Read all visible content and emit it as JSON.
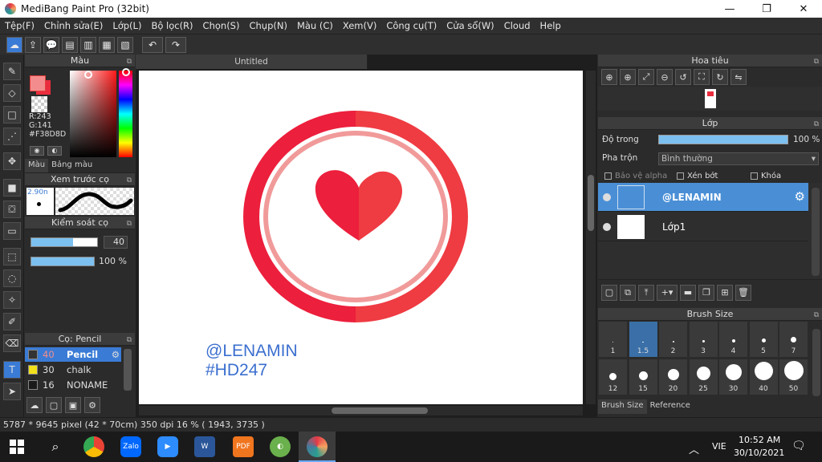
{
  "window": {
    "title": "MediBang Paint Pro (32bit)",
    "minimize": "—",
    "maximize": "❐",
    "close": "✕"
  },
  "menu": [
    "Tệp(F)",
    "Chỉnh sửa(E)",
    "Lớp(L)",
    "Bộ lọc(R)",
    "Chọn(S)",
    "Chụp(N)",
    "Màu (C)",
    "Xem(V)",
    "Công cụ(T)",
    "Cửa sổ(W)",
    "Cloud",
    "Help"
  ],
  "color_panel": {
    "title": "Màu",
    "r": "R:243",
    "g": "G:141",
    "hex": "#F38D8D",
    "tabs": [
      "Màu",
      "Bảng màu"
    ]
  },
  "brush_preview": {
    "title": "Xem trước cọ",
    "size": "2.90n"
  },
  "brush_control": {
    "title": "Kiểm soát cọ",
    "size_value": "40",
    "opacity_value": "100 %"
  },
  "brush_panel": {
    "title": "Cọ: Pencil",
    "items": [
      {
        "size": "40",
        "name": "Pencil",
        "color": "#F38D8D"
      },
      {
        "size": "30",
        "name": "chalk",
        "color": "#f2e11a"
      },
      {
        "size": "16",
        "name": "NONAME",
        "color": "#1a1a1a"
      }
    ]
  },
  "canvas": {
    "tab": "Untitled",
    "text1": "@LENAMIN",
    "text2": "#HD247"
  },
  "navigator": {
    "title": "Hoa tiêu"
  },
  "layer_panel": {
    "title": "Lớp",
    "opacity_label": "Độ trong",
    "opacity_value": "100 %",
    "opacity_fraction": 1.0,
    "blend_label": "Pha trộn",
    "blend_value": "Bình thường",
    "alpha_protect": "Bảo vệ alpha",
    "clipping": "Xén bớt",
    "lock": "Khóa",
    "layers": [
      {
        "name": "@LENAMIN",
        "selected": true
      },
      {
        "name": "Lớp1",
        "selected": false
      }
    ]
  },
  "brush_size": {
    "title": "Brush Size",
    "sizes": [
      "1",
      "1.5",
      "2",
      "3",
      "4",
      "5",
      "7",
      "12",
      "15",
      "20",
      "25",
      "30",
      "40",
      "50"
    ],
    "selected": "1.5",
    "tabs": [
      "Brush Size",
      "Reference"
    ]
  },
  "status": "5787 * 9645 pixel   (42 * 70cm)   350 dpi   16 %   ( 1943, 3735 )",
  "taskbar": {
    "lang": "VIE",
    "time": "10:52 AM",
    "date": "30/10/2021"
  },
  "accent_colors": {
    "selection": "#3a7bd5",
    "heart_red": "#ea2d3d",
    "heart_light": "#f03a3a"
  }
}
